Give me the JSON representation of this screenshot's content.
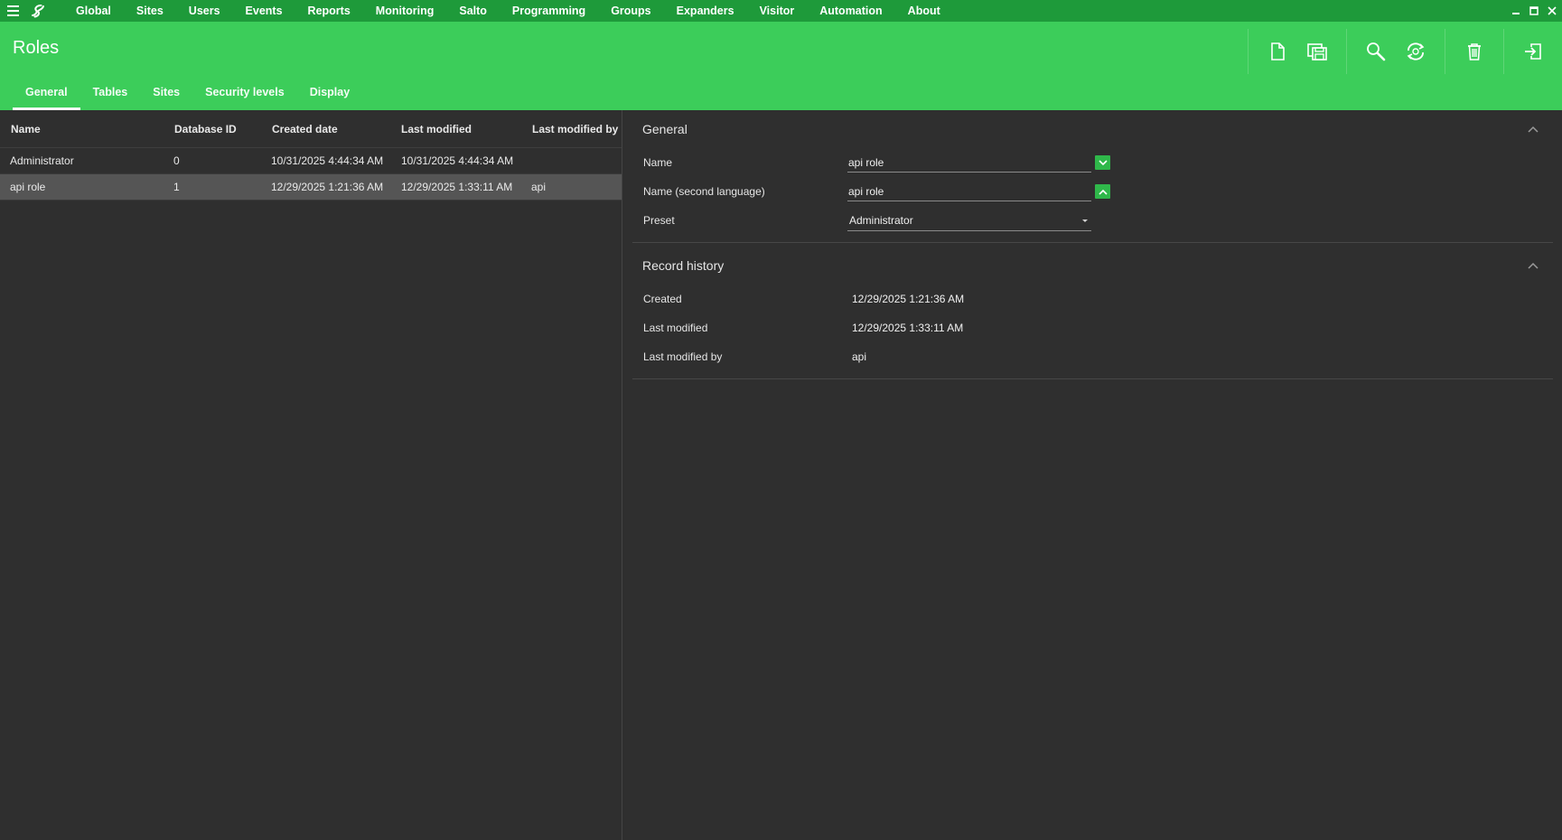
{
  "menubar": {
    "items": [
      "Global",
      "Sites",
      "Users",
      "Events",
      "Reports",
      "Monitoring",
      "Salto",
      "Programming",
      "Groups",
      "Expanders",
      "Visitor",
      "Automation",
      "About"
    ]
  },
  "header": {
    "title": "Roles",
    "tabs": [
      {
        "label": "General",
        "active": true
      },
      {
        "label": "Tables",
        "active": false
      },
      {
        "label": "Sites",
        "active": false
      },
      {
        "label": "Security levels",
        "active": false
      },
      {
        "label": "Display",
        "active": false
      }
    ],
    "toolbar_icons": [
      "new-document-icon",
      "save-icon",
      "search-icon",
      "refresh-icon",
      "delete-icon",
      "exit-icon"
    ]
  },
  "table": {
    "columns": [
      "Name",
      "Database ID",
      "Created date",
      "Last modified",
      "Last modified by"
    ],
    "rows": [
      {
        "name": "Administrator",
        "id": "0",
        "created": "10/31/2025 4:44:34 AM",
        "modified": "10/31/2025 4:44:34 AM",
        "modified_by": "",
        "selected": false
      },
      {
        "name": "api role",
        "id": "1",
        "created": "12/29/2025 1:21:36 AM",
        "modified": "12/29/2025 1:33:11 AM",
        "modified_by": "api",
        "selected": true
      }
    ]
  },
  "general": {
    "title": "General",
    "name_label": "Name",
    "name_value": "api role",
    "name2_label": "Name (second language)",
    "name2_value": "api role",
    "preset_label": "Preset",
    "preset_value": "Administrator"
  },
  "history": {
    "title": "Record history",
    "created_label": "Created",
    "created_value": "12/29/2025 1:21:36 AM",
    "modified_label": "Last modified",
    "modified_value": "12/29/2025 1:33:11 AM",
    "modified_by_label": "Last modified by",
    "modified_by_value": "api"
  },
  "colors": {
    "menubar": "#1e9a3a",
    "header": "#3ccd5a",
    "background": "#2f2f2f",
    "selected_row": "#555555",
    "accent_button": "#2fb84a"
  }
}
